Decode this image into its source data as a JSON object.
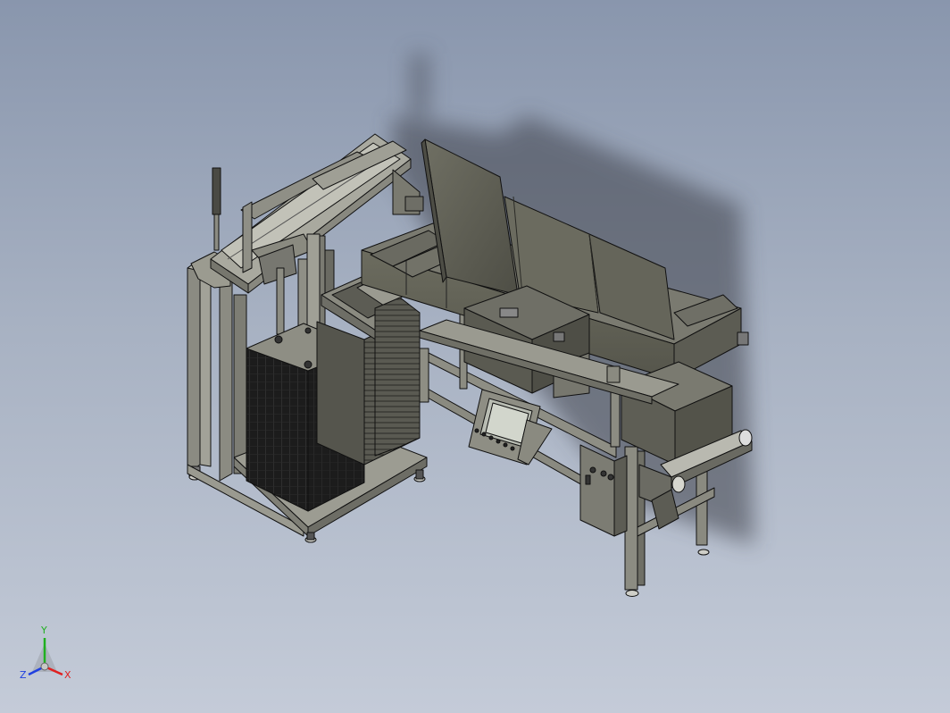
{
  "view": {
    "background_top": "#8996ad",
    "background_bottom": "#c4cbd8"
  },
  "triad": {
    "x_label": "X",
    "y_label": "Y",
    "z_label": "Z",
    "x_color": "#e02020",
    "y_color": "#20b020",
    "z_color": "#2040e0"
  }
}
